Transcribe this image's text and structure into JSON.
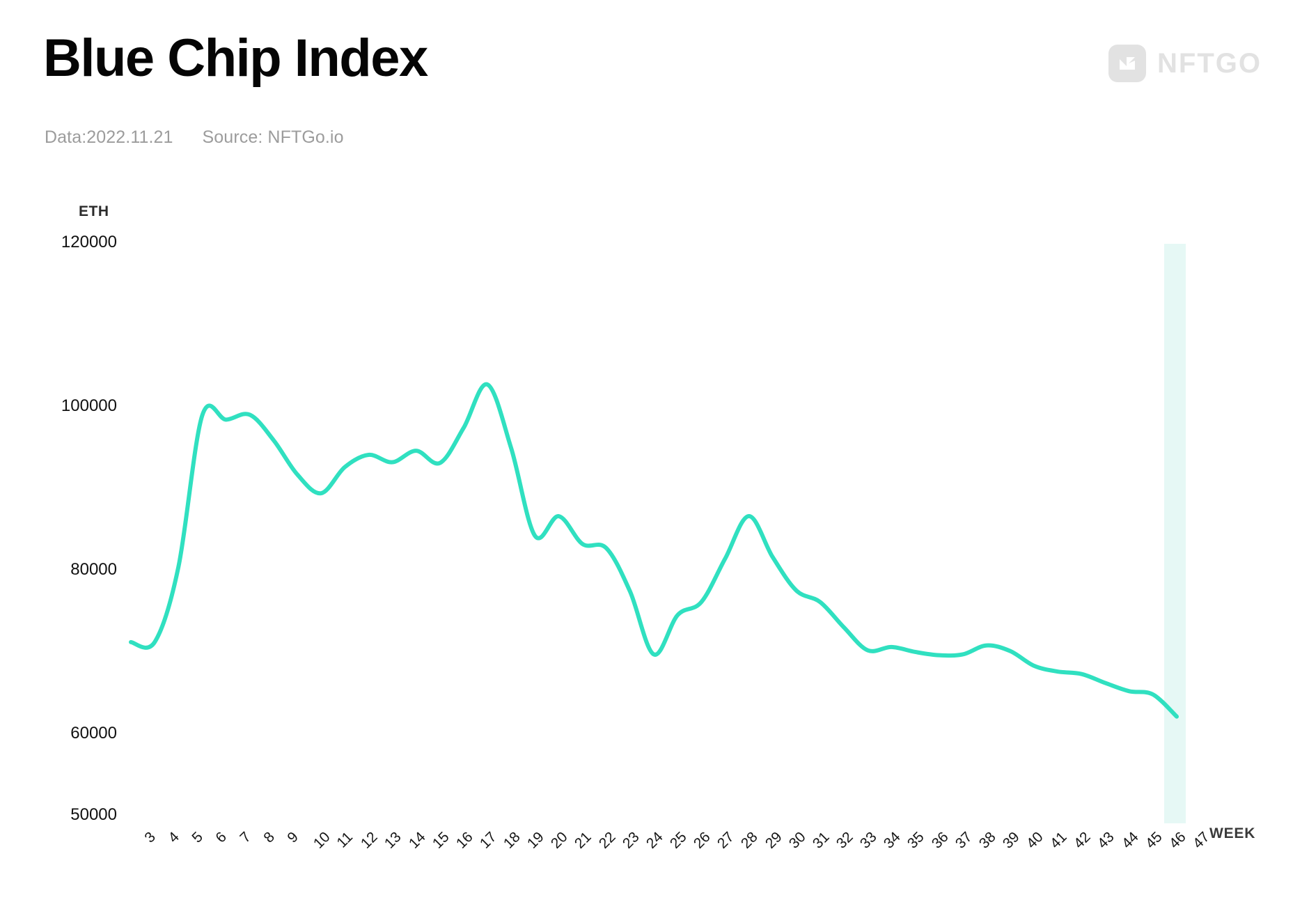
{
  "header": {
    "title": "Blue Chip Index",
    "data_label": "Data:2022.11.21",
    "source_label": "Source: NFTGo.io"
  },
  "brand": {
    "mark_icon": "nftgo-lightning-n-icon",
    "wordmark": "NFTGO",
    "logo_color": "#e2e2e2"
  },
  "chart_data": {
    "type": "line",
    "title": "Blue Chip Index",
    "xlabel": "WEEK",
    "ylabel": "ETH",
    "ylim": [
      50000,
      120000
    ],
    "yticks": [
      120000,
      100000,
      80000,
      60000,
      50000
    ],
    "ytick_labels": [
      "120000",
      "100000",
      "80000",
      "60000",
      "50000"
    ],
    "grid": false,
    "legend": false,
    "line_color": "#30e0c0",
    "line_width": 6,
    "highlight_band": {
      "week": 47,
      "color": "#e6f8f5",
      "label": "47"
    },
    "categories": [
      3,
      4,
      5,
      6,
      7,
      8,
      9,
      10,
      11,
      12,
      13,
      14,
      15,
      16,
      17,
      18,
      19,
      20,
      21,
      22,
      23,
      24,
      25,
      26,
      27,
      28,
      29,
      30,
      31,
      32,
      33,
      34,
      35,
      36,
      37,
      38,
      39,
      40,
      41,
      42,
      43,
      44,
      45,
      46,
      47
    ],
    "xtick_labels": [
      "3",
      "4",
      "5",
      "6",
      "7",
      "8",
      "9",
      "10",
      "11",
      "12",
      "13",
      "14",
      "15",
      "16",
      "17",
      "18",
      "19",
      "20",
      "21",
      "22",
      "23",
      "24",
      "25",
      "26",
      "27",
      "28",
      "29",
      "30",
      "31",
      "32",
      "33",
      "34",
      "35",
      "36",
      "37",
      "38",
      "39",
      "40",
      "41",
      "42",
      "43",
      "44",
      "45",
      "46",
      "47"
    ],
    "series": [
      {
        "name": "Blue Chip Index",
        "unit": "ETH",
        "values": [
          71300,
          71300,
          80500,
          99000,
          98500,
          99100,
          96000,
          91800,
          89500,
          92700,
          94200,
          93300,
          94700,
          93200,
          97500,
          102800,
          95000,
          84300,
          86700,
          83300,
          82800,
          77500,
          69800,
          74600,
          76200,
          81500,
          86700,
          81700,
          77600,
          76200,
          73100,
          70300,
          70700,
          70100,
          69700,
          69800,
          70900,
          70200,
          68400,
          67700,
          67400,
          66300,
          65300,
          64900,
          62200
        ]
      }
    ]
  }
}
